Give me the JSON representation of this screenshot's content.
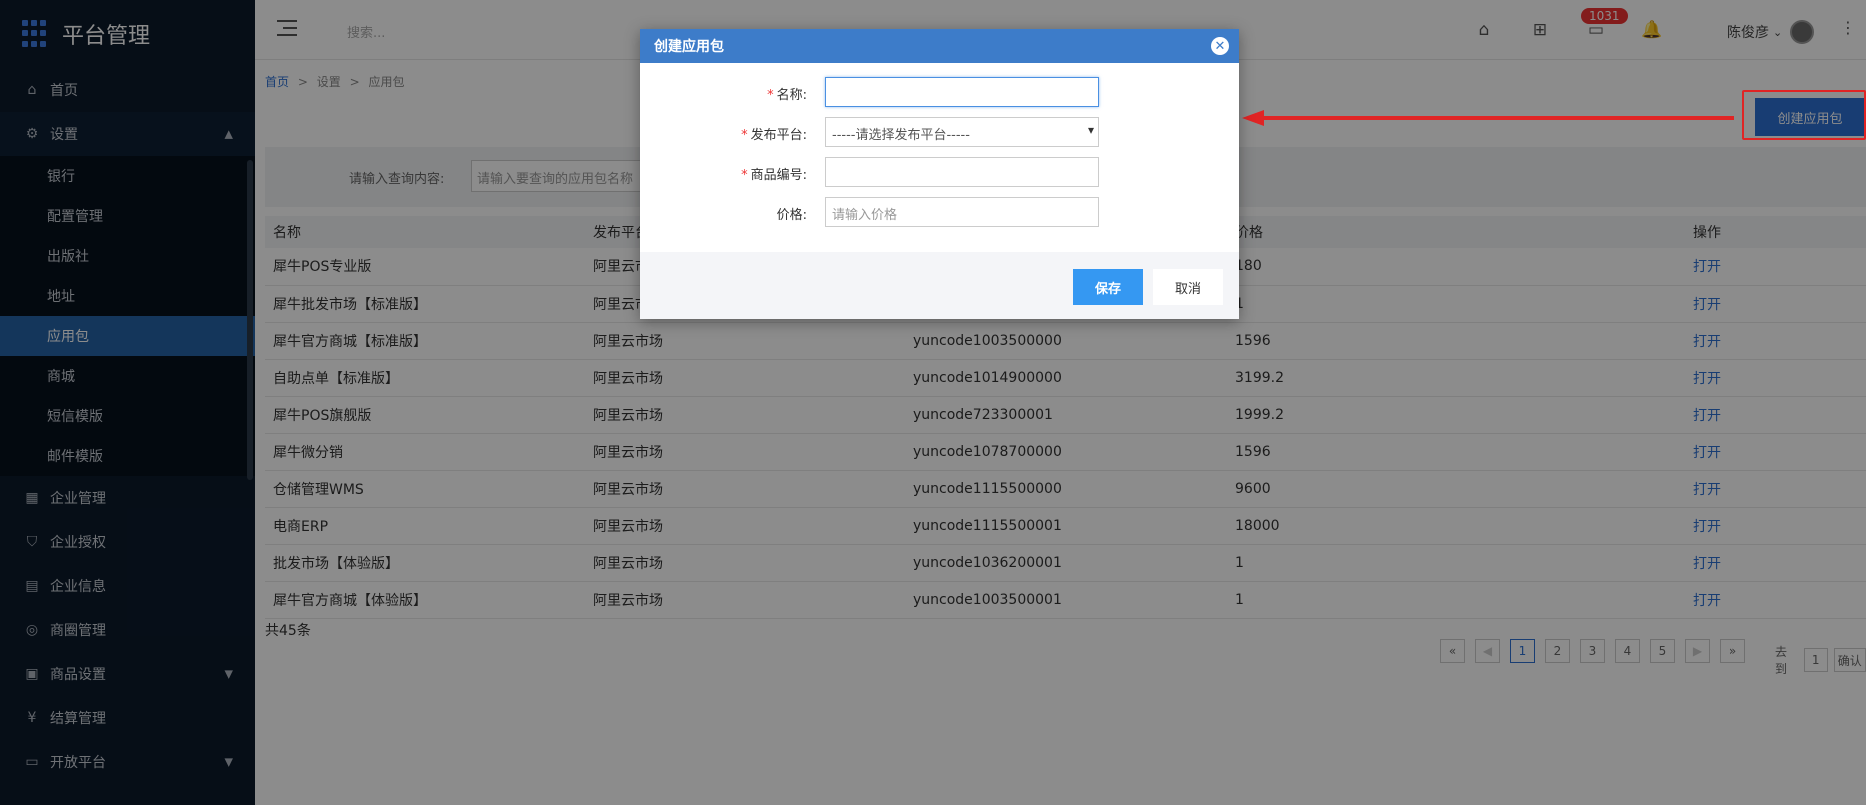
{
  "sidebar": {
    "title": "平台管理",
    "nav": [
      {
        "label": "首页",
        "icon": "home-icon"
      },
      {
        "label": "设置",
        "icon": "gear-icon",
        "open": true
      }
    ],
    "settings_sub": [
      "银行",
      "配置管理",
      "出版社",
      "地址",
      "应用包",
      "商城",
      "短信模版",
      "邮件模版"
    ],
    "active_sub": "应用包",
    "nav_more": [
      {
        "label": "企业管理",
        "icon": "building-icon"
      },
      {
        "label": "企业授权",
        "icon": "shield-check-icon"
      },
      {
        "label": "企业信息",
        "icon": "id-card-icon"
      },
      {
        "label": "商圈管理",
        "icon": "compass-icon"
      },
      {
        "label": "商品设置",
        "icon": "grid-icon",
        "chevron": true
      },
      {
        "label": "结算管理",
        "icon": "yen-icon"
      },
      {
        "label": "开放平台",
        "icon": "terminal-icon",
        "chevron": true
      }
    ]
  },
  "topbar": {
    "search_placeholder": "搜索...",
    "badge_count": "1031",
    "user_name": "陈俊彦"
  },
  "breadcrumb": {
    "home": "首页",
    "sep": ">",
    "level2": "设置",
    "level3": "应用包"
  },
  "create_button": "创建应用包",
  "filter": {
    "label": "请输入查询内容:",
    "placeholder": "请输入要查询的应用包名称"
  },
  "table": {
    "headers": [
      "名称",
      "发布平台",
      "",
      "价格",
      "操作"
    ],
    "rows": [
      {
        "name": "犀牛POS专业版",
        "platform": "阿里云市场",
        "code": "",
        "price": "180",
        "op": "打开"
      },
      {
        "name": "犀牛批发市场【标准版】",
        "platform": "阿里云市场",
        "code": "",
        "price": "1",
        "op": "打开"
      },
      {
        "name": "犀牛官方商城【标准版】",
        "platform": "阿里云市场",
        "code": "yuncode1003500000",
        "price": "1596",
        "op": "打开"
      },
      {
        "name": "自助点单【标准版】",
        "platform": "阿里云市场",
        "code": "yuncode1014900000",
        "price": "3199.2",
        "op": "打开"
      },
      {
        "name": "犀牛POS旗舰版",
        "platform": "阿里云市场",
        "code": "yuncode723300001",
        "price": "1999.2",
        "op": "打开"
      },
      {
        "name": "犀牛微分销",
        "platform": "阿里云市场",
        "code": "yuncode1078700000",
        "price": "1596",
        "op": "打开"
      },
      {
        "name": "仓储管理WMS",
        "platform": "阿里云市场",
        "code": "yuncode1115500000",
        "price": "9600",
        "op": "打开"
      },
      {
        "name": "电商ERP",
        "platform": "阿里云市场",
        "code": "yuncode1115500001",
        "price": "18000",
        "op": "打开"
      },
      {
        "name": "批发市场【体验版】",
        "platform": "阿里云市场",
        "code": "yuncode1036200001",
        "price": "1",
        "op": "打开"
      },
      {
        "name": "犀牛官方商城【体验版】",
        "platform": "阿里云市场",
        "code": "yuncode1003500001",
        "price": "1",
        "op": "打开"
      }
    ],
    "total": "共45条"
  },
  "pagination": {
    "first": "«",
    "prev": "◀",
    "pages": [
      "1",
      "2",
      "3",
      "4",
      "5"
    ],
    "current": "1",
    "next": "▶",
    "last": "»",
    "goto_label": "去到",
    "goto_value": "1",
    "confirm": "确认"
  },
  "modal": {
    "title": "创建应用包",
    "fields": [
      {
        "label": "名称:",
        "required": true,
        "value": "",
        "placeholder": ""
      },
      {
        "label": "发布平台:",
        "required": true,
        "value": "-----请选择发布平台-----",
        "type": "select"
      },
      {
        "label": "商品编号:",
        "required": true,
        "value": "",
        "placeholder": ""
      },
      {
        "label": "价格:",
        "required": false,
        "value": "",
        "placeholder": "请输入价格"
      }
    ],
    "save": "保存",
    "cancel": "取消",
    "required_mark": "*"
  },
  "colors": {
    "accent": "#2c6fd1",
    "sidebar": "#0b1a2b",
    "modal_header": "#3d7cc9",
    "annotation": "#e02424"
  }
}
